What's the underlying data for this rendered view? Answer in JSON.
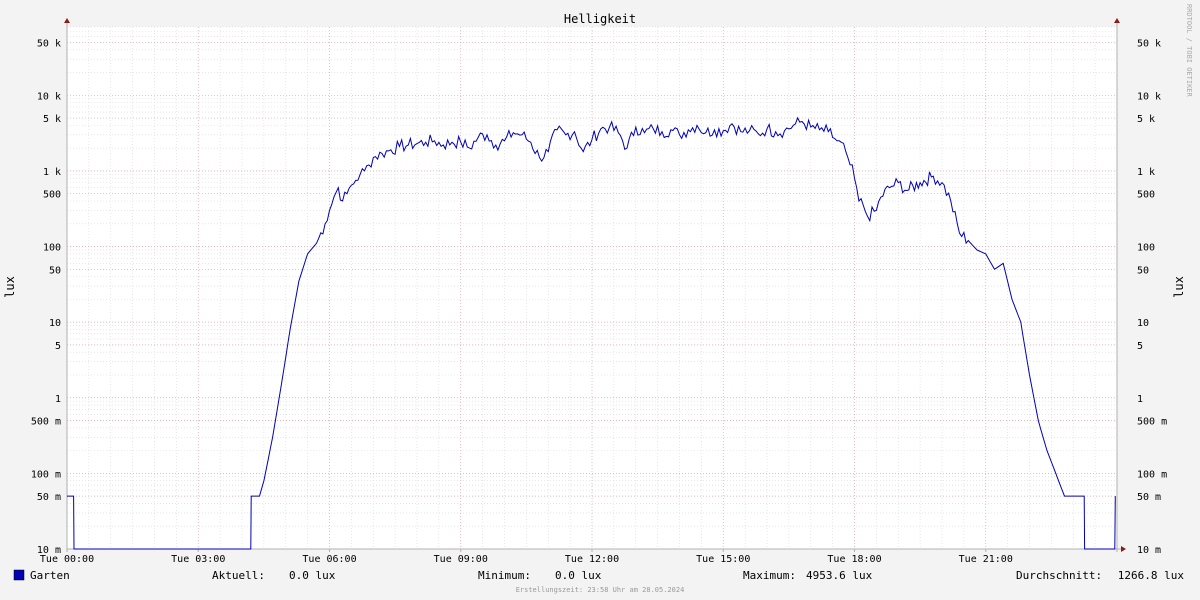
{
  "colors": {
    "background": "#f3f3f3",
    "plot_background": "#ffffff",
    "axis": "#b0b0b0",
    "minor_grid": "#d8d8d8",
    "major_grid": "#e3a0a8",
    "arrow": "#8b1a1a",
    "series": "#0000b4"
  },
  "chart_data": {
    "type": "line",
    "title": "Helligkeit",
    "ylabel": "lux",
    "yscale": "log",
    "ylim": [
      0.01,
      80000
    ],
    "xlim": [
      0,
      24
    ],
    "grid": true,
    "x_tick_labels": [
      {
        "x": 0,
        "label": "Tue 00:00"
      },
      {
        "x": 3,
        "label": "Tue 03:00"
      },
      {
        "x": 6,
        "label": "Tue 06:00"
      },
      {
        "x": 9,
        "label": "Tue 09:00"
      },
      {
        "x": 12,
        "label": "Tue 12:00"
      },
      {
        "x": 15,
        "label": "Tue 15:00"
      },
      {
        "x": 18,
        "label": "Tue 18:00"
      },
      {
        "x": 21,
        "label": "Tue 21:00"
      }
    ],
    "y_tick_labels": [
      {
        "y": 0.01,
        "label": "10 m"
      },
      {
        "y": 0.05,
        "label": "50 m"
      },
      {
        "y": 0.1,
        "label": "100 m"
      },
      {
        "y": 0.5,
        "label": "500 m"
      },
      {
        "y": 1,
        "label": "1"
      },
      {
        "y": 5,
        "label": "5"
      },
      {
        "y": 10,
        "label": "10"
      },
      {
        "y": 50,
        "label": "50"
      },
      {
        "y": 100,
        "label": "100"
      },
      {
        "y": 500,
        "label": "500"
      },
      {
        "y": 1000,
        "label": "1 k"
      },
      {
        "y": 5000,
        "label": "5 k"
      },
      {
        "y": 10000,
        "label": "10 k"
      },
      {
        "y": 50000,
        "label": "50 k"
      }
    ],
    "series": [
      {
        "name": "Garten",
        "x_unit": "hour",
        "x": [
          0,
          0.15,
          0.16,
          4.2,
          4.21,
          4.4,
          4.5,
          4.7,
          4.9,
          5.1,
          5.3,
          5.5,
          5.7,
          5.9,
          6.0,
          6.1,
          6.2,
          6.3,
          6.4,
          6.5,
          6.6,
          6.7,
          6.8,
          6.9,
          7.0,
          7.2,
          7.4,
          7.6,
          7.8,
          8.0,
          8.2,
          8.4,
          8.6,
          8.8,
          9.0,
          9.2,
          9.4,
          9.6,
          9.8,
          10.0,
          10.2,
          10.4,
          10.6,
          10.8,
          11.0,
          11.2,
          11.4,
          11.6,
          11.8,
          12.0,
          12.2,
          12.4,
          12.6,
          12.8,
          13.0,
          13.2,
          13.4,
          13.6,
          13.8,
          14.0,
          14.2,
          14.4,
          14.6,
          14.8,
          15.0,
          15.2,
          15.4,
          15.6,
          15.8,
          16.0,
          16.2,
          16.4,
          16.6,
          16.8,
          17.0,
          17.2,
          17.4,
          17.6,
          17.8,
          17.9,
          18.0,
          18.1,
          18.2,
          18.3,
          18.5,
          18.6,
          18.8,
          19.0,
          19.2,
          19.5,
          19.8,
          20.0,
          20.2,
          20.4,
          20.6,
          20.8,
          21.0,
          21.2,
          21.4,
          21.6,
          21.8,
          22.0,
          22.2,
          22.4,
          22.6,
          22.8,
          23.0,
          23.1,
          23.2,
          23.25,
          23.26,
          23.95,
          23.96
        ],
        "values": [
          0.05,
          0.05,
          0.01,
          0.01,
          0.05,
          0.05,
          0.08,
          0.3,
          1.5,
          8,
          35,
          80,
          110,
          200,
          300,
          450,
          600,
          400,
          500,
          650,
          750,
          900,
          1000,
          1200,
          1500,
          1700,
          1900,
          2100,
          2200,
          2300,
          2400,
          2500,
          2200,
          2400,
          2400,
          2000,
          2800,
          3000,
          2200,
          2500,
          3200,
          3000,
          2400,
          1500,
          1800,
          3500,
          3000,
          3300,
          1800,
          2600,
          3600,
          3800,
          3200,
          2000,
          3800,
          3200,
          3600,
          3300,
          3500,
          3000,
          3500,
          4000,
          3200,
          3500,
          3400,
          4200,
          3300,
          3400,
          3100,
          3600,
          3300,
          3400,
          4000,
          4500,
          3800,
          3500,
          3300,
          2500,
          1800,
          1200,
          800,
          400,
          350,
          250,
          300,
          450,
          600,
          700,
          550,
          700,
          850,
          700,
          400,
          150,
          120,
          90,
          80,
          50,
          60,
          20,
          10,
          2,
          0.5,
          0.2,
          0.1,
          0.05,
          0.05,
          0.05,
          0.05,
          0.05,
          0.01,
          0.01,
          0.05
        ]
      }
    ]
  },
  "legend": {
    "series_label": "Garten",
    "aktuell_label": "Aktuell:",
    "aktuell_value": "0.0 lux",
    "minimum_label": "Minimum:",
    "minimum_value": "0.0 lux",
    "maximum_label": "Maximum:",
    "maximum_value": "4953.6 lux",
    "durchschnitt_label": "Durchschnitt:",
    "durchschnitt_value": "1266.8 lux"
  },
  "footer": "Erstellungszeit: 23:58 Uhr am 28.05.2024",
  "side_note": "RRDTOOL / TOBI OETIKER"
}
